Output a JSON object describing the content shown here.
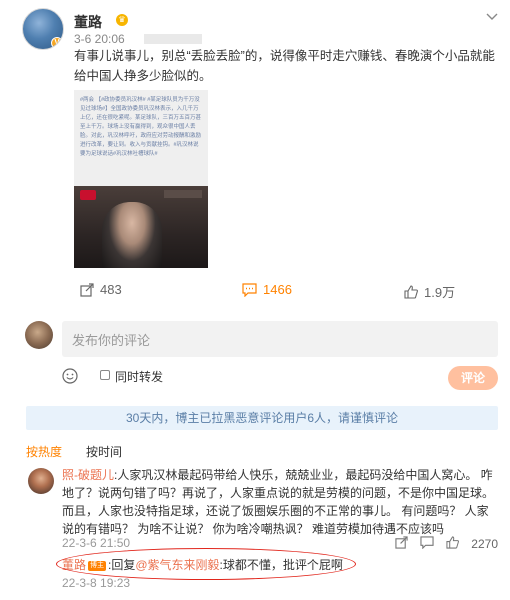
{
  "post": {
    "author": "董路",
    "time": "3-6 20:06",
    "text": "有事儿说事儿，别总“丢脸丢脸”的，说得像平时走穴赚钱、春晚演个小品就能给中国人挣多少脸似的。",
    "thumb_text": "#两会 【#政协委员巩汉林# #某足球队员为千万没见过球场#】全国政协委员巩汉林表示，入几千万上亿，还在很吃紧呢。某足球队，三百万五百万甚至上千万。球场上没有赢得到，观众很中国人丢脸。对此，巩汉林呼吁，政府应对劳动报酬和激励进行改革，要让到。收入与贡献挂钩。#巩汉林说要为足球说话#巩汉林吐槽球队#"
  },
  "actions": {
    "repost_count": "483",
    "comment_count": "1466",
    "like_count": "1.9万"
  },
  "compose": {
    "placeholder": "发布你的评论",
    "repost_label": "同时转发",
    "submit_label": "评论"
  },
  "notice": "30天内，博主已拉黑恶意评论用户6人，请谨慎评论",
  "sort": {
    "hot": "按热度",
    "time": "按时间"
  },
  "comment": {
    "user": "照-破题儿",
    "text": ":人家巩汉林最起码带给人快乐，兢兢业业，最起码没给中国人窝心。 咋地了？说两句错了吗？再说了，人家重点说的就是劳模的问题，不是你中国足球。而且，人家也没特指足球，还说了饭圈娱乐圈的不正常的事儿。 有问题吗？ 人家说的有错吗？ 为啥不让说？ 你为啥冷嘲热讽？ 难道劳模加待遇不应该吗",
    "time": "22-3-6 21:50",
    "like_count": "2270"
  },
  "reply": {
    "user": "董路",
    "badge": "博主",
    "prefix": ":回复",
    "mention": "@紫气东来刚毅",
    "text": ":球都不懂，批评个屁啊",
    "time": "22-3-8 19:23"
  },
  "icons": {
    "more": "chevron-down-icon",
    "repost": "repost-icon",
    "comment": "comment-icon",
    "like": "thumbs-up-icon",
    "emoji": "emoji-icon"
  },
  "colors": {
    "accent": "#ff8200",
    "username": "#eb7350",
    "notice_bg": "#e8f2fb",
    "highlight": "#e1261c"
  }
}
